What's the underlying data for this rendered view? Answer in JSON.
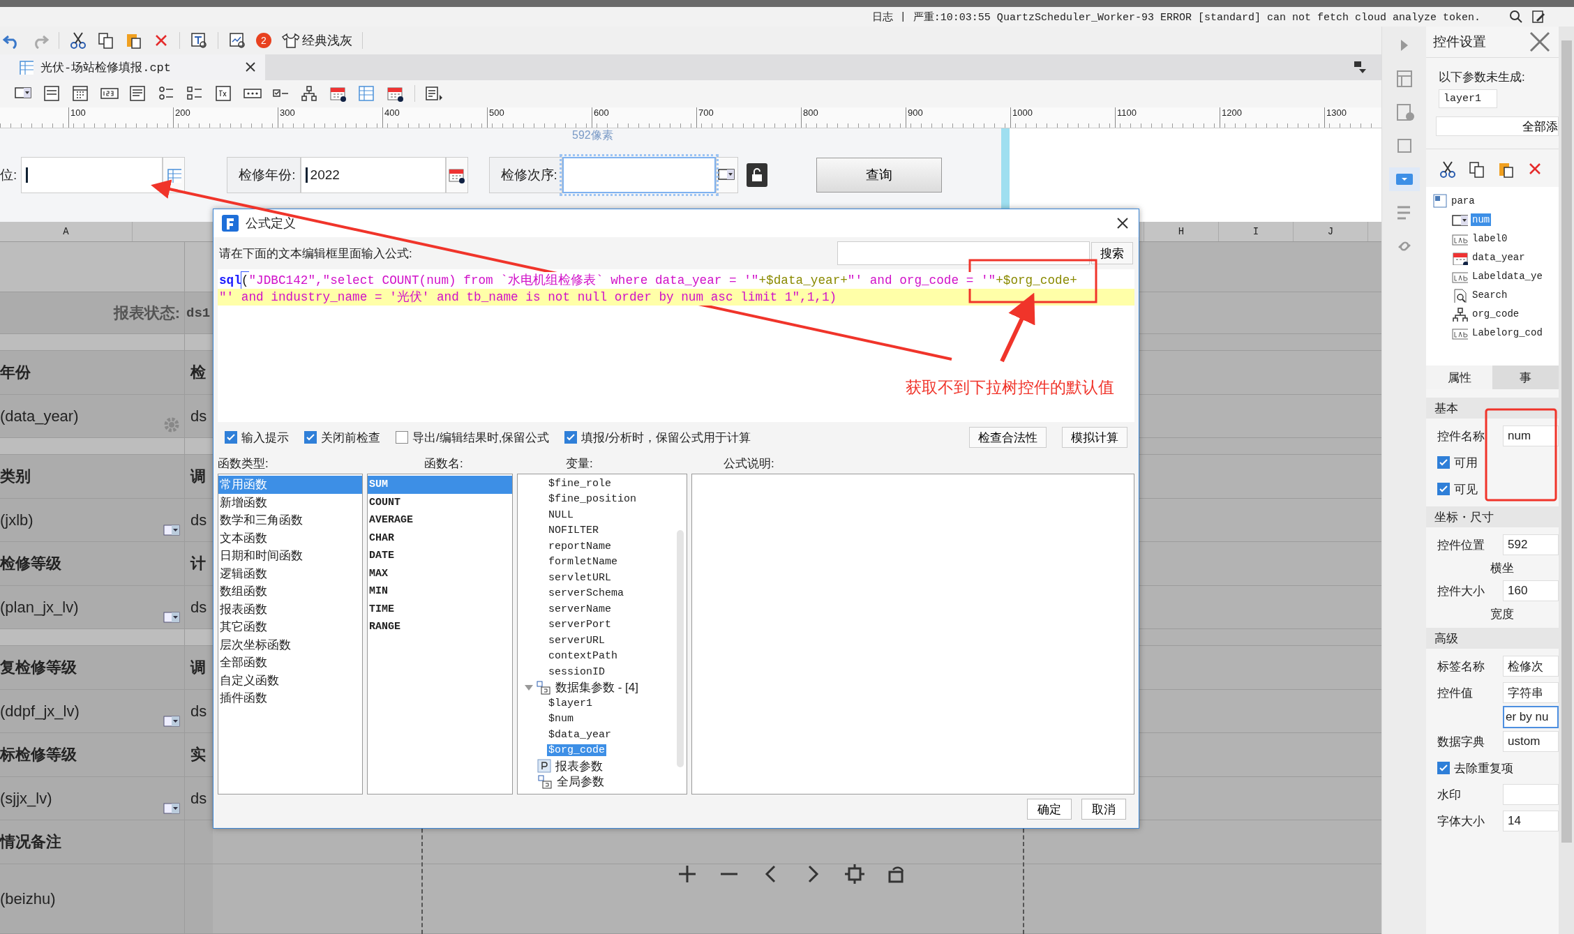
{
  "log_bar": {
    "items": [
      "日志",
      "|",
      "严重:10:03:55 QuartzScheduler_Worker-93 ERROR [standard] can not fetch cloud analyze token."
    ]
  },
  "toolbar": {
    "badge": "2",
    "theme_label": "经典浅灰"
  },
  "tabs": [
    {
      "label": "光伏-场站检修填报.cpt",
      "selected": true
    }
  ],
  "ruler": {
    "ticks": [
      "100",
      "200",
      "300",
      "400",
      "500",
      "600",
      "700",
      "800",
      "900",
      "1000",
      "1100",
      "1200",
      "1300"
    ],
    "marker": "592像素"
  },
  "parameter_panel": {
    "fields": [
      {
        "label": "位:",
        "kind": "tree",
        "selected": false
      },
      {
        "label": "检修年份:",
        "value": "2022",
        "kind": "date",
        "selected": false
      },
      {
        "label": "检修次序:",
        "kind": "dropdown",
        "selected": true
      }
    ],
    "button": "查询"
  },
  "sheet": {
    "columns_left": [
      "A"
    ],
    "columns_right": [
      "H",
      "I",
      "J"
    ],
    "rows": [
      {
        "kind": "blank"
      },
      {
        "kind": "status",
        "label": "报表状态:",
        "value": "ds1"
      },
      {
        "kind": "gap"
      },
      {
        "kind": "heading",
        "label": "年份",
        "value": "检"
      },
      {
        "kind": "field",
        "label": "(data_year)",
        "value": "ds",
        "widget": {
          "kind": "gear"
        }
      },
      {
        "kind": "gap"
      },
      {
        "kind": "heading",
        "label": "类别",
        "value": "调"
      },
      {
        "kind": "field",
        "label": "(jxlb)",
        "value": "ds",
        "widget": {
          "kind": "dropdown"
        }
      },
      {
        "kind": "heading",
        "label": "检修等级",
        "value": "计"
      },
      {
        "kind": "field",
        "label": "(plan_jx_lv)",
        "value": "ds",
        "widget": {
          "kind": "dropdown"
        }
      },
      {
        "kind": "gap"
      },
      {
        "kind": "heading",
        "label": "复检修等级",
        "value": "调"
      },
      {
        "kind": "field",
        "label": "(ddpf_jx_lv)",
        "value": "ds",
        "widget": {
          "kind": "dropdown"
        }
      },
      {
        "kind": "heading",
        "label": "标检修等级",
        "value": "实"
      },
      {
        "kind": "field",
        "label": "(sjjx_lv)",
        "value": "ds",
        "widget": {
          "kind": "dropdown"
        }
      },
      {
        "kind": "heading",
        "label": "情况备注"
      },
      {
        "kind": "tall",
        "label": "(beizhu)"
      }
    ]
  },
  "dialog": {
    "title": "公式定义",
    "prompt": "请在下面的文本编辑框里面输入公式:",
    "search_button": "搜索",
    "editor": [
      {
        "highlighted": false,
        "segments": [
          {
            "kind": "keyword",
            "text": "sql"
          },
          {
            "kind": "bracket",
            "text": "("
          },
          {
            "kind": "string",
            "text": "\"JDBC142\",\"select COUNT(num) from `水电机组检修表` where data_year = '\""
          },
          {
            "kind": "variable",
            "text": "+$data_year+"
          },
          {
            "kind": "string",
            "text": "\"' and org_code = '\""
          },
          {
            "kind": "variable",
            "text": "+$org_code+"
          }
        ]
      },
      {
        "highlighted": true,
        "segments": [
          {
            "kind": "string",
            "text": "\"' and industry_name = '光伏' and tb_name is not null order by num asc limit 1\",1,1)"
          }
        ]
      }
    ],
    "options": [
      {
        "label": "输入提示",
        "checked": true
      },
      {
        "label": "关闭前检查",
        "checked": true
      },
      {
        "label": "导出/编辑结果时,保留公式",
        "checked": false
      },
      {
        "label": "填报/分析时，保留公式用于计算",
        "checked": true
      }
    ],
    "action_buttons": [
      "检查合法性",
      "模拟计算"
    ],
    "headers": [
      "函数类型:",
      "函数名:",
      "变量:",
      "公式说明:"
    ],
    "function_types": [
      {
        "label": "常用函数",
        "selected": true
      },
      {
        "label": "新增函数",
        "selected": false
      },
      {
        "label": "数学和三角函数",
        "selected": false
      },
      {
        "label": "文本函数",
        "selected": false
      },
      {
        "label": "日期和时间函数",
        "selected": false
      },
      {
        "label": "逻辑函数",
        "selected": false
      },
      {
        "label": "数组函数",
        "selected": false
      },
      {
        "label": "报表函数",
        "selected": false
      },
      {
        "label": "其它函数",
        "selected": false
      },
      {
        "label": "层次坐标函数",
        "selected": false
      },
      {
        "label": "全部函数",
        "selected": false
      },
      {
        "label": "自定义函数",
        "selected": false
      },
      {
        "label": "插件函数",
        "selected": false
      }
    ],
    "function_names": [
      {
        "label": "SUM",
        "selected": true
      },
      {
        "label": "COUNT",
        "selected": false
      },
      {
        "label": "AVERAGE",
        "selected": false
      },
      {
        "label": "CHAR",
        "selected": false
      },
      {
        "label": "DATE",
        "selected": false
      },
      {
        "label": "MAX",
        "selected": false
      },
      {
        "label": "MIN",
        "selected": false
      },
      {
        "label": "TIME",
        "selected": false
      },
      {
        "label": "RANGE",
        "selected": false
      }
    ],
    "variables": [
      {
        "kind": "leaf",
        "label": "$fine_role",
        "selected": false
      },
      {
        "kind": "leaf",
        "label": "$fine_position",
        "selected": false
      },
      {
        "kind": "leaf",
        "label": "NULL",
        "selected": false
      },
      {
        "kind": "leaf",
        "label": "NOFILTER",
        "selected": false
      },
      {
        "kind": "leaf",
        "label": "reportName",
        "selected": false
      },
      {
        "kind": "leaf",
        "label": "formletName",
        "selected": false
      },
      {
        "kind": "leaf",
        "label": "servletURL",
        "selected": false
      },
      {
        "kind": "leaf",
        "label": "serverSchema",
        "selected": false
      },
      {
        "kind": "leaf",
        "label": "serverName",
        "selected": false
      },
      {
        "kind": "leaf",
        "label": "serverPort",
        "selected": false
      },
      {
        "kind": "leaf",
        "label": "serverURL",
        "selected": false
      },
      {
        "kind": "leaf",
        "label": "contextPath",
        "selected": false
      },
      {
        "kind": "leaf",
        "label": "sessionID",
        "selected": false
      },
      {
        "kind": "dataset",
        "label": "数据集参数 - [4]",
        "selected": false,
        "expanded": true,
        "children": [
          {
            "kind": "leaf",
            "label": "$layer1",
            "selected": false
          },
          {
            "kind": "leaf",
            "label": "$num",
            "selected": false
          },
          {
            "kind": "leaf",
            "label": "$data_year",
            "selected": false
          },
          {
            "kind": "leaf",
            "label": "$org_code",
            "selected": true
          }
        ]
      },
      {
        "kind": "report",
        "label": "报表参数",
        "selected": false
      },
      {
        "kind": "global",
        "label": "全局参数",
        "selected": false
      }
    ],
    "ok_button": "确定",
    "cancel_button": "取消"
  },
  "annotation_note": "获取不到下拉树控件的默认值",
  "side_strip": [
    {
      "kind": "arrow",
      "selected": false
    },
    {
      "kind": "form",
      "selected": false
    },
    {
      "kind": "info",
      "selected": false
    },
    {
      "kind": "frame",
      "selected": false
    },
    {
      "kind": "widget",
      "selected": true
    },
    {
      "kind": "list",
      "selected": false
    },
    {
      "kind": "link",
      "selected": false
    }
  ],
  "settings_panel": {
    "title": "控件设置",
    "notice": "以下参数未生成:",
    "param_chip": "layer1",
    "add_all_button": "全部添",
    "tree": {
      "label": "para",
      "children": [
        {
          "label": "num",
          "kind": "dropdown",
          "selected": true
        },
        {
          "label": "label0",
          "kind": "label",
          "selected": false
        },
        {
          "label": "data_year",
          "kind": "date",
          "selected": false
        },
        {
          "label": "Labeldata_ye",
          "kind": "label",
          "selected": false
        },
        {
          "label": "Search",
          "kind": "search",
          "selected": false
        },
        {
          "label": "org_code",
          "kind": "tree",
          "selected": false
        },
        {
          "label": "Labelorg_cod",
          "kind": "label",
          "selected": false
        }
      ]
    },
    "tabs": [
      {
        "label": "属性",
        "selected": true
      },
      {
        "label": "事",
        "selected": false
      }
    ],
    "properties": [
      {
        "kind": "section",
        "label": "基本"
      },
      {
        "kind": "field",
        "label": "控件名称",
        "value": "num"
      },
      {
        "kind": "checkbox",
        "label": "可用",
        "checked": true
      },
      {
        "kind": "checkbox",
        "label": "可见",
        "checked": true
      },
      {
        "kind": "section",
        "label": "坐标・尺寸"
      },
      {
        "kind": "field",
        "label": "控件位置",
        "value": "592",
        "hint": "横坐"
      },
      {
        "kind": "field",
        "label": "控件大小",
        "value": "160",
        "hint": "宽度"
      },
      {
        "kind": "section",
        "label": "高级"
      },
      {
        "kind": "field",
        "label": "标签名称",
        "value": "检修次"
      },
      {
        "kind": "field",
        "label": "控件值",
        "value": "字符串",
        "extra": "er by nu"
      },
      {
        "kind": "field",
        "label": "数据字典",
        "value": "ustom"
      },
      {
        "kind": "checkbox",
        "label": "去除重复项",
        "checked": true
      },
      {
        "kind": "field",
        "label": "水印"
      },
      {
        "kind": "field",
        "label": "字体大小",
        "value": "14"
      }
    ]
  }
}
